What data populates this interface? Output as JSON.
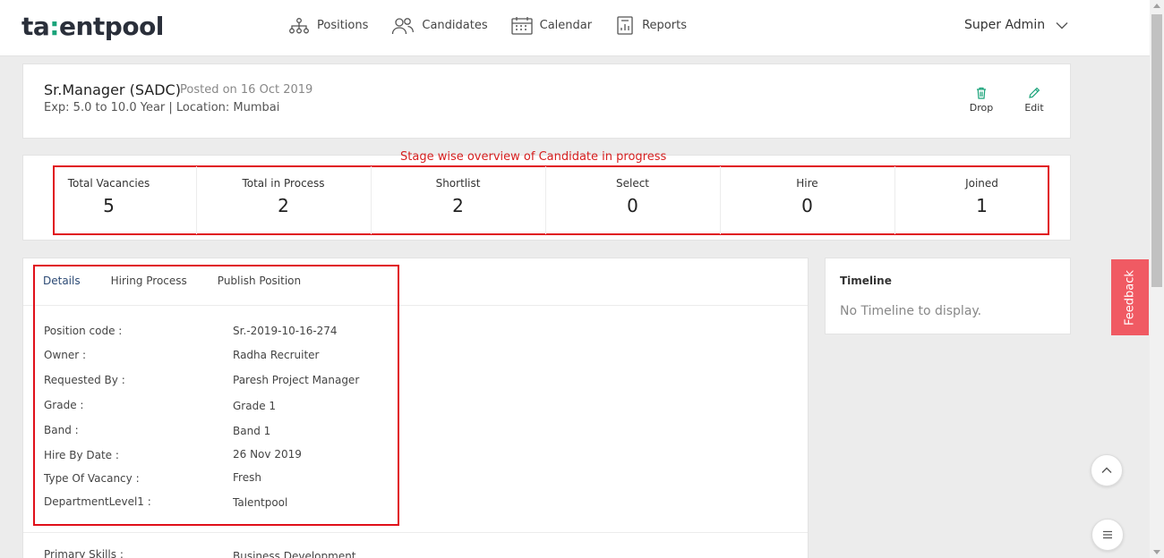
{
  "app": {
    "logo_pre": "ta",
    "logo_accent": ":",
    "logo_post": "entpool"
  },
  "nav": {
    "items": [
      {
        "label": "Positions",
        "icon": "org-chart-icon"
      },
      {
        "label": "Candidates",
        "icon": "users-icon"
      },
      {
        "label": "Calendar",
        "icon": "calendar-icon"
      },
      {
        "label": "Reports",
        "icon": "report-icon"
      }
    ]
  },
  "user": {
    "name": "Super Admin"
  },
  "position": {
    "title": "Sr.Manager (SADC)",
    "posted": "Posted on 16 Oct 2019",
    "meta": "Exp: 5.0 to 10.0 Year | Location: Mumbai",
    "actions": {
      "drop": "Drop",
      "edit": "Edit"
    }
  },
  "stats": {
    "annotation": "Stage wise overview of Candidate in progress",
    "items": [
      {
        "label": "Total Vacancies",
        "value": "5"
      },
      {
        "label": "Total in Process",
        "value": "2"
      },
      {
        "label": "Shortlist",
        "value": "2"
      },
      {
        "label": "Select",
        "value": "0"
      },
      {
        "label": "Hire",
        "value": "0"
      },
      {
        "label": "Joined",
        "value": "1"
      }
    ]
  },
  "tabs": [
    "Details",
    "Hiring Process",
    "Publish Position"
  ],
  "details": [
    {
      "label": "Position code :",
      "value": "Sr.-2019-10-16-274"
    },
    {
      "label": "Owner :",
      "value": "Radha Recruiter"
    },
    {
      "label": "Requested By :",
      "value": "Paresh Project Manager"
    },
    {
      "label": "Grade :",
      "value": "Grade 1"
    },
    {
      "label": "Band :",
      "value": "Band 1"
    },
    {
      "label": "Hire By Date :",
      "value": "26 Nov 2019"
    },
    {
      "label": "Type Of Vacancy :",
      "value": "Fresh"
    },
    {
      "label": "DepartmentLevel1 :",
      "value": "Talentpool"
    },
    {
      "label": "Primary Skills :",
      "value": "Business Development"
    }
  ],
  "timeline": {
    "title": "Timeline",
    "empty": "No Timeline to display."
  },
  "feedback": {
    "label": "Feedback"
  },
  "colors": {
    "accent": "#1aa37a",
    "annotation": "#e0101a",
    "feedback": "#f05a63",
    "tab_active": "#2c4a75"
  }
}
